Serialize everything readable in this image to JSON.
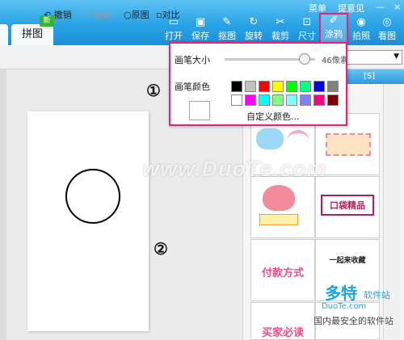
{
  "top_links": {
    "menu": "菜单",
    "feedback": "提意见",
    "minimize": "—",
    "close": "×"
  },
  "tabs": {
    "puzzle": "拼图",
    "new_badge": "新"
  },
  "toolbar": [
    {
      "label": "打开",
      "icon": "folder-icon"
    },
    {
      "label": "保存",
      "icon": "save-icon"
    },
    {
      "label": "抠图",
      "icon": "cutout-icon"
    },
    {
      "label": "旋转",
      "icon": "rotate-icon"
    },
    {
      "label": "裁剪",
      "icon": "crop-icon"
    },
    {
      "label": "尺寸",
      "icon": "resize-icon"
    },
    {
      "label": "涂鸦",
      "icon": "brush-icon"
    },
    {
      "label": "拍照",
      "icon": "camera-icon"
    },
    {
      "label": "看图",
      "icon": "eye-icon"
    }
  ],
  "edit_bar": {
    "undo": "撤销",
    "redo": "重做",
    "original": "原图",
    "compare": "对比"
  },
  "popup": {
    "brush_size_label": "画笔大小",
    "brush_size_value": "46像素",
    "brush_color_label": "画笔颜色",
    "custom_color": "自定义颜色...",
    "colors_row1": [
      "#000000",
      "#c0c0c0",
      "#ff0000",
      "#ffff00",
      "#00ff00",
      "#00ff80",
      "#0000ff",
      "#808080"
    ],
    "colors_row2": [
      "#ffffff",
      "#ff00ff",
      "#00ffff",
      "#80ff80",
      "#80ffff",
      "#8080ff",
      "#ff0080",
      "#800000"
    ]
  },
  "annotations": {
    "one": "①",
    "two": "②"
  },
  "right_panel": {
    "header_tag": "[S]",
    "thumbs": [
      {
        "text": ""
      },
      {
        "text": ""
      },
      {
        "text": ""
      },
      {
        "text": "口袋精品"
      },
      {
        "text": "付款方式"
      },
      {
        "text": "一起来收藏"
      },
      {
        "text": "买家必读"
      }
    ]
  },
  "watermarks": {
    "main": "www.DuoTe.com",
    "site": "多特",
    "site_sub": "软件站",
    "url": "DuoTe.com",
    "slogan": "国内最安全的软件站"
  }
}
